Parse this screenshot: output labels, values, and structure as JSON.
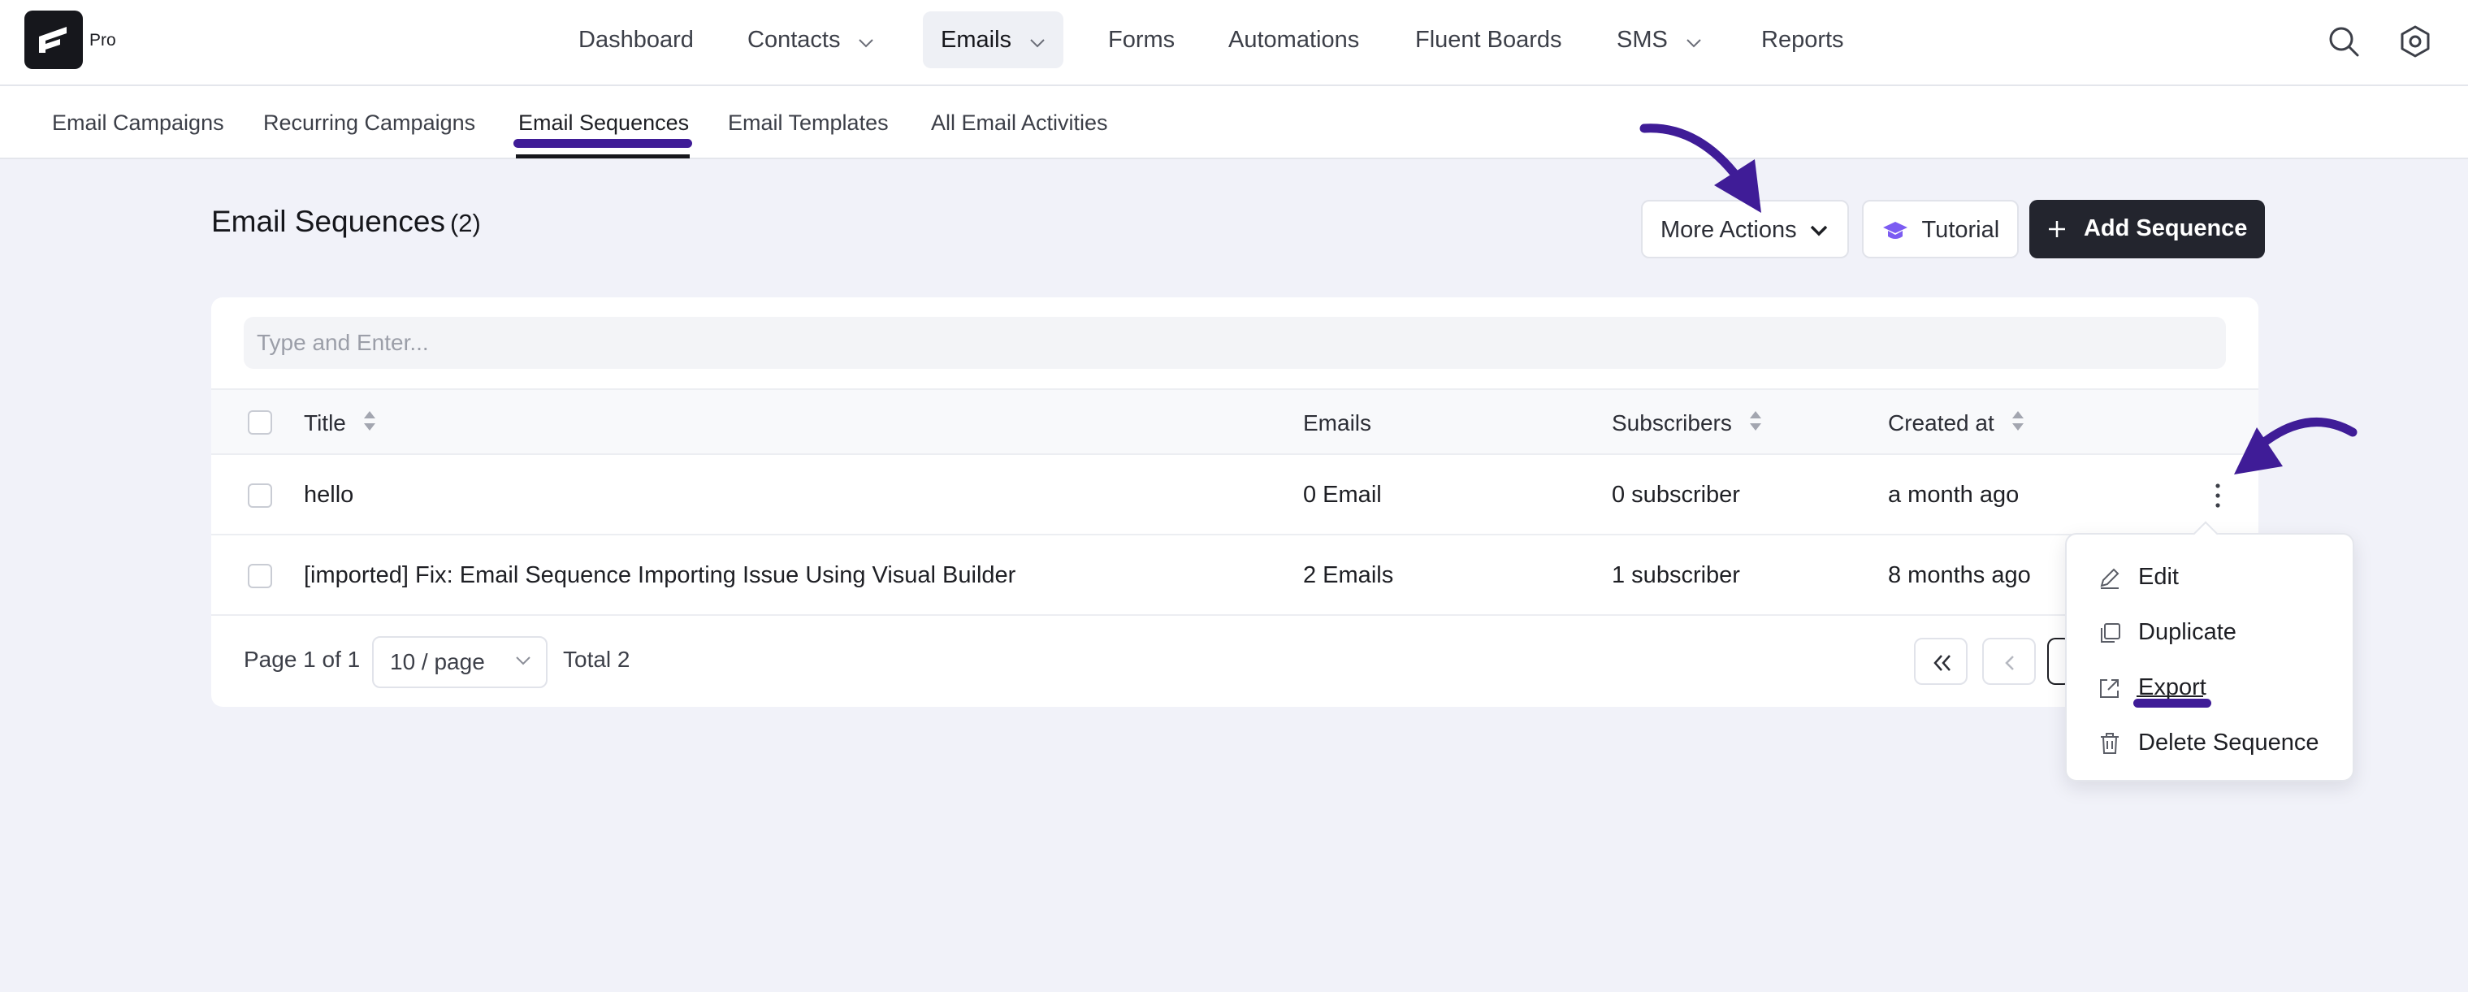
{
  "brand": {
    "logo_text": "Pro"
  },
  "nav": {
    "items": [
      {
        "label": "Dashboard"
      },
      {
        "label": "Contacts"
      },
      {
        "label": "Emails"
      },
      {
        "label": "Forms"
      },
      {
        "label": "Automations"
      },
      {
        "label": "Fluent Boards"
      },
      {
        "label": "SMS"
      },
      {
        "label": "Reports"
      }
    ],
    "active": "Emails"
  },
  "subnav": {
    "items": [
      {
        "label": "Email Campaigns"
      },
      {
        "label": "Recurring Campaigns"
      },
      {
        "label": "Email Sequences"
      },
      {
        "label": "Email Templates"
      },
      {
        "label": "All Email Activities"
      }
    ],
    "active": "Email Sequences"
  },
  "header": {
    "title": "Email Sequences",
    "count": "(2)",
    "more_actions": "More Actions",
    "tutorial": "Tutorial",
    "add_sequence": "Add Sequence"
  },
  "search": {
    "placeholder": "Type and Enter..."
  },
  "table": {
    "columns": [
      {
        "label": "Title"
      },
      {
        "label": "Emails"
      },
      {
        "label": "Subscribers"
      },
      {
        "label": "Created at"
      }
    ],
    "rows": [
      {
        "title": "hello",
        "emails": "0 Email",
        "subscribers": "0 subscriber",
        "created": "a month ago"
      },
      {
        "title": "[imported] Fix: Email Sequence Importing Issue Using Visual Builder",
        "emails": "2 Emails",
        "subscribers": "1 subscriber",
        "created": "8 months ago"
      }
    ]
  },
  "pagination": {
    "page_text": "Page 1 of 1",
    "per_page": "10 / page",
    "total": "Total 2"
  },
  "row_menu": {
    "items": [
      {
        "label": "Edit",
        "icon": "edit-icon"
      },
      {
        "label": "Duplicate",
        "icon": "duplicate-icon"
      },
      {
        "label": "Export",
        "icon": "export-icon"
      },
      {
        "label": "Delete Sequence",
        "icon": "trash-icon"
      }
    ]
  },
  "colors": {
    "annotation": "#3f1c97",
    "dark_button": "#23252e",
    "page_bg": "#f1f2f9",
    "tutorial_icon": "#7c5cf2"
  }
}
